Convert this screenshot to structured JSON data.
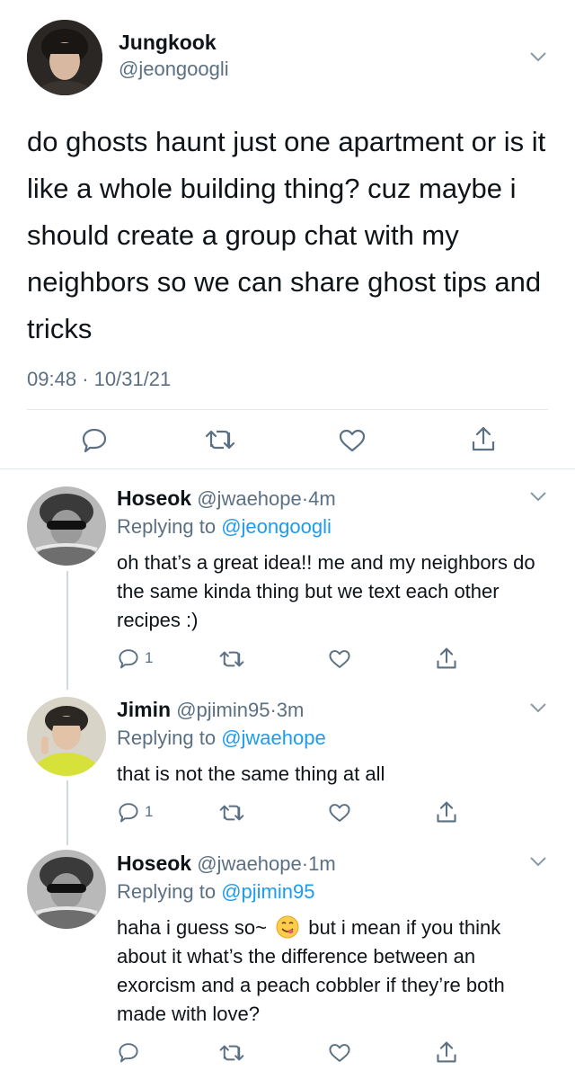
{
  "main_tweet": {
    "name": "Jungkook",
    "handle": "@jeongoogli",
    "text": "do ghosts haunt just one apartment or is it like a whole building thing? cuz maybe i should create a group chat with my neighbors so we can share ghost tips and tricks",
    "time": "09:48",
    "date": "10/31/21",
    "separator": "·"
  },
  "replies": [
    {
      "name": "Hoseok",
      "handle": "@jwaehope",
      "age": "4m",
      "replying_prefix": "Replying to",
      "replying_to": "@jeongoogli",
      "text": "oh that’s a great idea!! me and my neighbors do the same kinda thing but we text each other recipes :)",
      "reply_count": "1"
    },
    {
      "name": "Jimin",
      "handle": "@pjimin95",
      "age": "3m",
      "replying_prefix": "Replying to",
      "replying_to": "@jwaehope",
      "text": "that is not the same thing at all",
      "reply_count": "1"
    },
    {
      "name": "Hoseok",
      "handle": "@jwaehope",
      "age": "1m",
      "replying_prefix": "Replying to",
      "replying_to": "@pjimin95",
      "text_before_emoji": "haha i guess so~",
      "text_after_emoji": "but i mean if you think about it what’s the difference between an exorcism and a peach cobbler if they’re both made with love?",
      "reply_count": ""
    }
  ],
  "icons": {
    "reply": "reply-icon",
    "retweet": "retweet-icon",
    "like": "heart-icon",
    "share": "share-icon",
    "more": "chevron-down-icon"
  },
  "colors": {
    "link_blue": "#1d9bf0",
    "secondary_gray": "#5b7083",
    "divider": "#e1e8ed"
  }
}
